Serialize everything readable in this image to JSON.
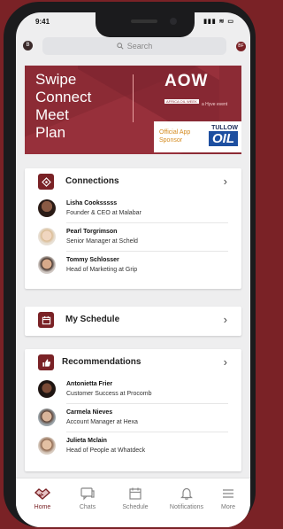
{
  "status_bar": {
    "time": "9:41",
    "icons": "▮▮▮ ≋ ▭"
  },
  "header": {
    "avatar_initials": "B",
    "search_placeholder": "Search",
    "right_badge": "BF"
  },
  "banner": {
    "tagline": [
      "Swipe",
      "Connect",
      "Meet",
      "Plan"
    ],
    "logo": "AOW",
    "logo_subtitle": "AFRICA OIL WEEK",
    "hyve": "a Hyve event",
    "sponsor_label_line1": "Official App",
    "sponsor_label_line2": "Sponsor",
    "sponsor_name_top": "TULLOW",
    "sponsor_name_bottom": "OIL"
  },
  "connections": {
    "title": "Connections",
    "people": [
      {
        "name": "Lisha Cooksssss",
        "role": "Founder & CEO at Malabar"
      },
      {
        "name": "Pearl Torgrimson",
        "role": "Senior Manager at Scheld"
      },
      {
        "name": "Tommy Schlosser",
        "role": "Head of Marketing at Grip"
      }
    ]
  },
  "schedule": {
    "title": "My Schedule"
  },
  "recommendations": {
    "title": "Recommendations",
    "people": [
      {
        "name": "Antonietta Frier",
        "role": "Customer Success at Procomb"
      },
      {
        "name": "Carmela Nieves",
        "role": "Account Manager at Hexa"
      },
      {
        "name": "Julieta Mclain",
        "role": "Head of People at Whatdeck"
      }
    ]
  },
  "tabs": [
    {
      "label": "Home",
      "icon": "handshake-icon",
      "active": true
    },
    {
      "label": "Chats",
      "icon": "chat-icon",
      "active": false
    },
    {
      "label": "Schedule",
      "icon": "calendar-icon",
      "active": false
    },
    {
      "label": "Notifications",
      "icon": "bell-icon",
      "active": false
    },
    {
      "label": "More",
      "icon": "menu-icon",
      "active": false
    }
  ],
  "colors": {
    "brand": "#7a2226",
    "banner": "#8c2b35",
    "sponsor_accent": "#d48a1e"
  }
}
